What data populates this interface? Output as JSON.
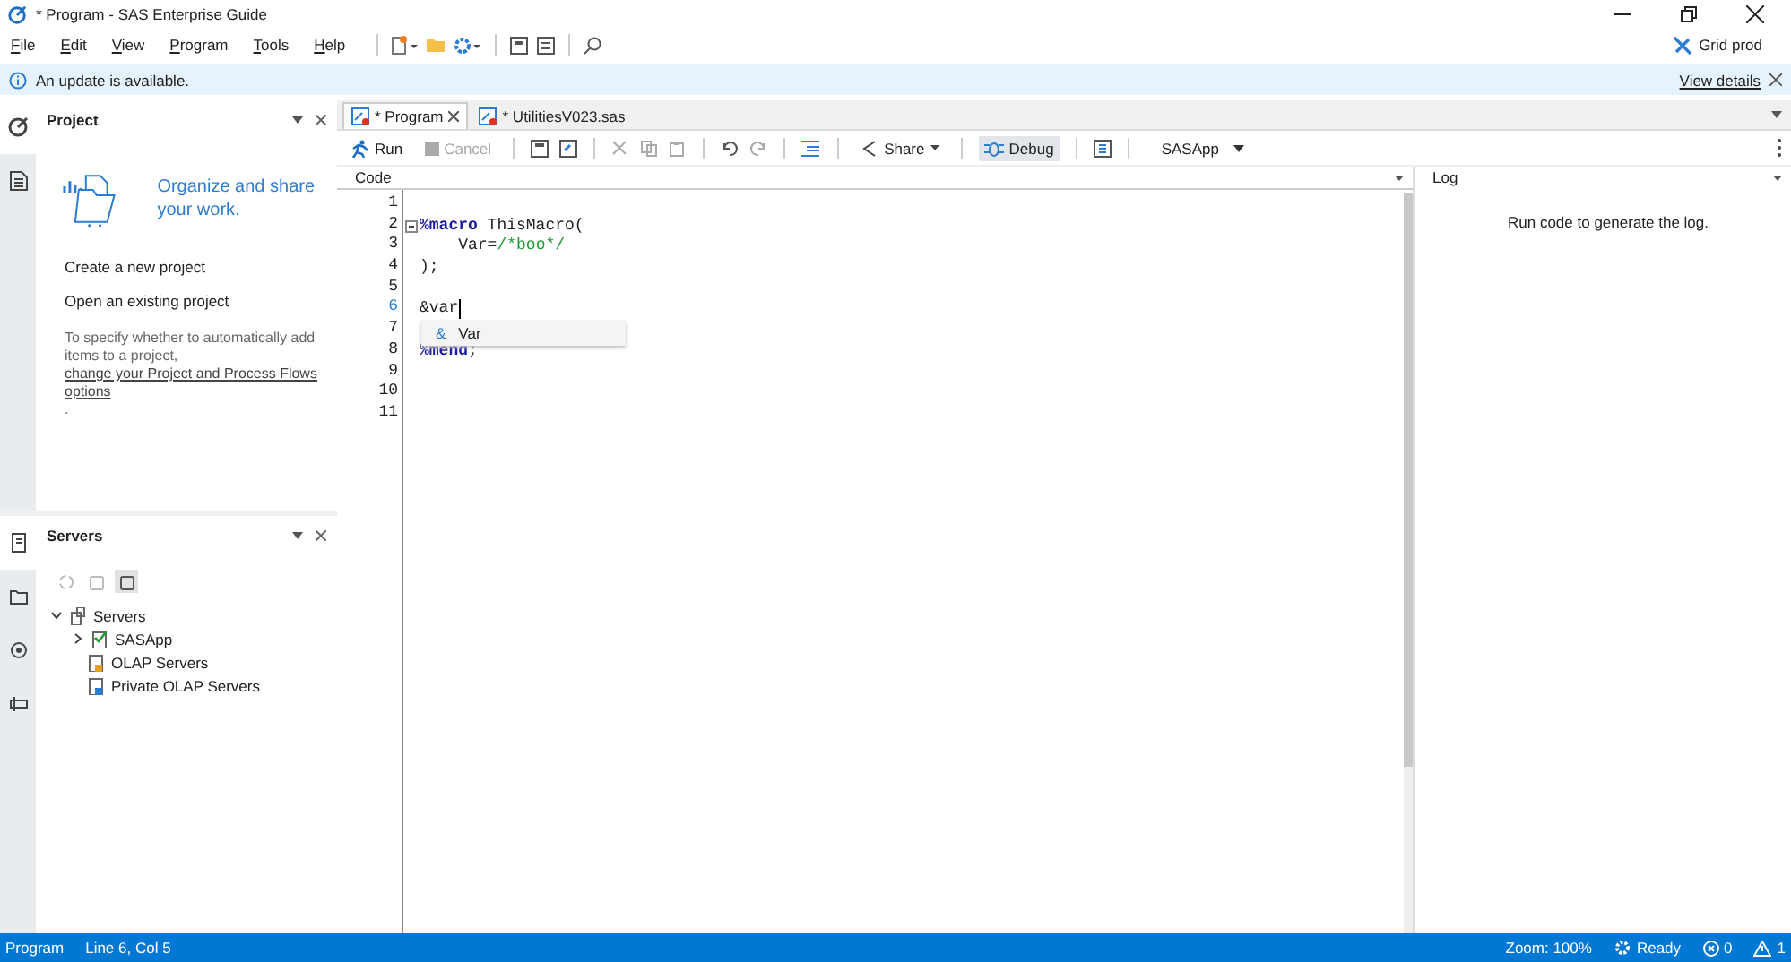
{
  "window": {
    "title": "* Program - SAS Enterprise Guide"
  },
  "menu": [
    "File",
    "Edit",
    "View",
    "Program",
    "Tools",
    "Help"
  ],
  "profile": {
    "label": "Grid prod"
  },
  "notification": {
    "text": "An update is available.",
    "link": "View details"
  },
  "rail_top": [
    {
      "selected": true
    },
    {
      "selected": false
    }
  ],
  "project": {
    "title": "Project",
    "headline": "Organize and share your work.",
    "actions": [
      "Create a new project",
      "Open an existing project"
    ],
    "hint": {
      "before": "To specify whether to automatically add items to a project, ",
      "link": "change your Project and Process Flows options",
      "after": "."
    }
  },
  "rail_bottom": [
    {
      "selected": true
    },
    {
      "selected": false
    },
    {
      "selected": false
    },
    {
      "selected": false
    }
  ],
  "servers": {
    "title": "Servers",
    "tools": [
      {
        "disabled": true
      },
      {
        "disabled": true
      },
      {
        "selected": true
      }
    ],
    "tree": [
      {
        "label": "Servers",
        "expanded": true,
        "children": [
          {
            "label": "SASApp",
            "expanded": false
          },
          {
            "label": "OLAP Servers"
          },
          {
            "label": "Private OLAP Servers"
          }
        ]
      }
    ]
  },
  "tabs": [
    {
      "label": "* Program",
      "selected": true
    },
    {
      "label": "* UtilitiesV023.sas",
      "selected": false
    }
  ],
  "toolbar": {
    "run": {
      "label": "Run",
      "disabled": false
    },
    "cancel": {
      "label": "Cancel",
      "disabled": true
    },
    "share": {
      "label": "Share"
    },
    "debug": {
      "label": "Debug",
      "selected": true
    },
    "server": {
      "label": "SASApp"
    }
  },
  "code_panel": {
    "title": "Code",
    "lines": [
      {
        "number": "1",
        "current": false,
        "foldable": false
      },
      {
        "number": "2",
        "current": false,
        "foldable": true,
        "tokens": [
          {
            "kind": "keyword",
            "text": "%macro"
          },
          {
            "kind": "plain",
            "text": " ThisMacro("
          }
        ]
      },
      {
        "number": "3",
        "current": false,
        "foldable": false,
        "tokens": [
          {
            "kind": "plain",
            "text": "    Var="
          },
          {
            "kind": "comment",
            "text": "/*boo*/"
          }
        ]
      },
      {
        "number": "4",
        "current": false,
        "foldable": false,
        "tokens": [
          {
            "kind": "plain",
            "text": ");"
          }
        ]
      },
      {
        "number": "5",
        "current": false,
        "foldable": false
      },
      {
        "number": "6",
        "current": true,
        "foldable": false,
        "tokens": [
          {
            "kind": "plain",
            "text": "&var"
          }
        ]
      },
      {
        "number": "7",
        "current": false,
        "foldable": false
      },
      {
        "number": "8",
        "current": false,
        "foldable": false,
        "tokens": [
          {
            "kind": "keyword",
            "text": "%mend"
          },
          {
            "kind": "plain",
            "text": ";"
          }
        ]
      },
      {
        "number": "9",
        "current": false,
        "foldable": false
      },
      {
        "number": "10",
        "current": false,
        "foldable": false
      },
      {
        "number": "11",
        "current": false,
        "foldable": false
      }
    ],
    "suggestion": {
      "symbol": "&",
      "text": "Var"
    }
  },
  "log_panel": {
    "title": "Log",
    "message": "Run code to generate the log."
  },
  "status_bar": {
    "mode": "Program",
    "position": "Line 6, Col 5",
    "zoom": "Zoom: 100%",
    "state": "Ready",
    "errors": "0",
    "warnings": "1"
  }
}
